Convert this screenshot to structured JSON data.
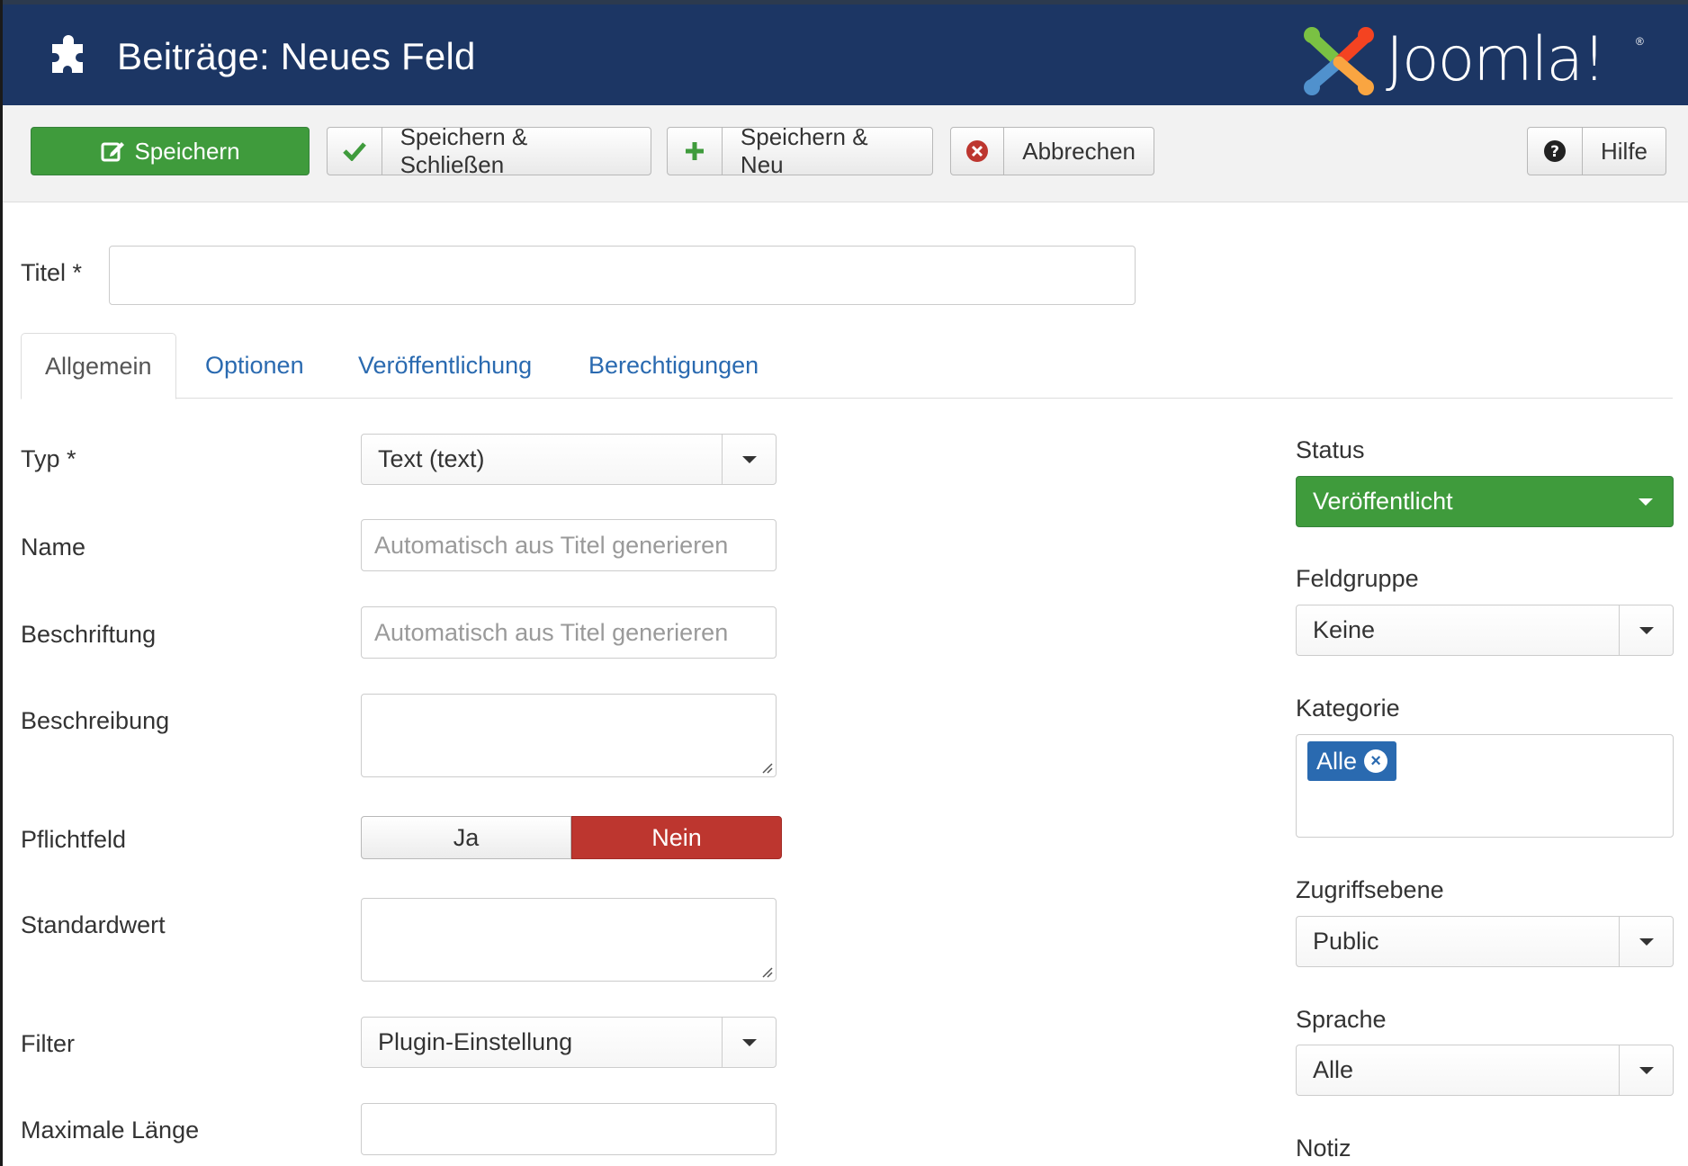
{
  "header": {
    "title": "Beiträge: Neues Feld",
    "logo_text": "Joomla!",
    "logo_reg": "®",
    "header_icon": "puzzle-icon"
  },
  "toolbar": {
    "save_label": "Speichern",
    "save_close_label": "Speichern & Schließen",
    "save_new_label": "Speichern & Neu",
    "cancel_label": "Abbrechen",
    "help_label": "Hilfe",
    "icons": {
      "save": "edit-icon",
      "save_close": "check-icon",
      "save_new": "plus-icon",
      "cancel": "cancel-icon",
      "help": "question-icon"
    }
  },
  "title_field": {
    "label": "Titel *",
    "value": ""
  },
  "tabs": [
    {
      "label": "Allgemein",
      "active": true
    },
    {
      "label": "Optionen",
      "active": false
    },
    {
      "label": "Veröffentlichung",
      "active": false
    },
    {
      "label": "Berechtigungen",
      "active": false
    }
  ],
  "form": {
    "typ": {
      "label": "Typ *",
      "value": "Text (text)"
    },
    "name": {
      "label": "Name",
      "value": "",
      "placeholder": "Automatisch aus Titel generieren"
    },
    "beschriftung": {
      "label": "Beschriftung",
      "value": "",
      "placeholder": "Automatisch aus Titel generieren"
    },
    "beschreibung": {
      "label": "Beschreibung",
      "value": ""
    },
    "pflichtfeld": {
      "label": "Pflichtfeld",
      "yes": "Ja",
      "no": "Nein",
      "selected": "Nein"
    },
    "standardwert": {
      "label": "Standardwert",
      "value": ""
    },
    "filter": {
      "label": "Filter",
      "value": "Plugin-Einstellung"
    },
    "maximale_laenge": {
      "label": "Maximale Länge",
      "value": ""
    }
  },
  "sidebar": {
    "status": {
      "label": "Status",
      "value": "Veröffentlicht"
    },
    "feldgruppe": {
      "label": "Feldgruppe",
      "value": "Keine"
    },
    "kategorie": {
      "label": "Kategorie",
      "chip": "Alle"
    },
    "zugriffsebene": {
      "label": "Zugriffsebene",
      "value": "Public"
    },
    "sprache": {
      "label": "Sprache",
      "value": "Alle"
    },
    "notiz": {
      "label": "Notiz"
    }
  },
  "colors": {
    "header_bg": "#1c3664",
    "success": "#3f9b3c",
    "danger": "#bd362f",
    "link": "#2a6ab0",
    "toolbar_bg": "#f2f2f2"
  }
}
